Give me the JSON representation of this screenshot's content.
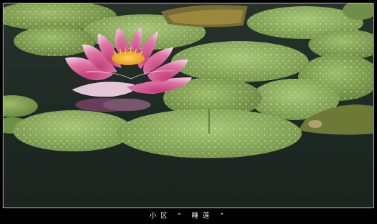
{
  "caption": "小区 “ 睡莲 ”",
  "colors": {
    "frame": "#000000",
    "water": "#1f2a24",
    "pad": "#8fae5c",
    "pad_dark": "#5f7f3a",
    "petal": "#d24f8a",
    "petal_light": "#f2c6dc",
    "stamen": "#f2b233"
  }
}
